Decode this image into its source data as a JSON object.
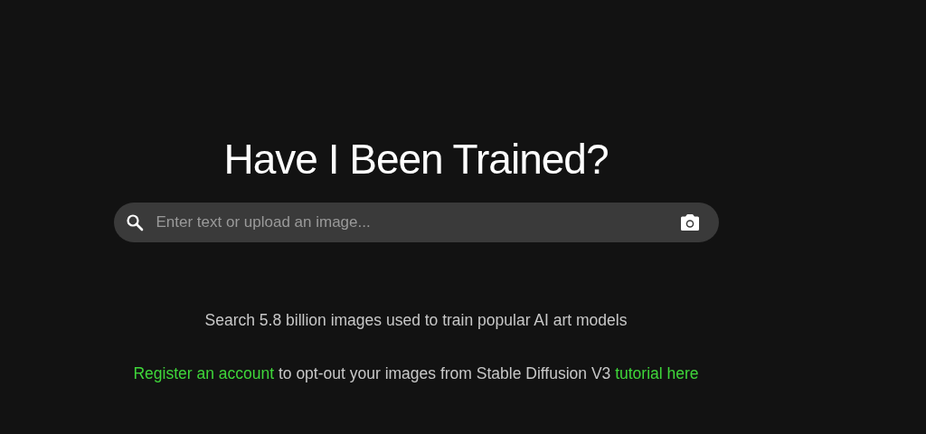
{
  "title": "Have I Been Trained?",
  "search": {
    "placeholder": "Enter text or upload an image..."
  },
  "subtitle": "Search 5.8 billion images used to train popular AI art models",
  "notice": {
    "link": "Register an account",
    "text": " to opt-out your images from Stable Diffusion V3 ",
    "tutorial_link": "tutorial here"
  }
}
